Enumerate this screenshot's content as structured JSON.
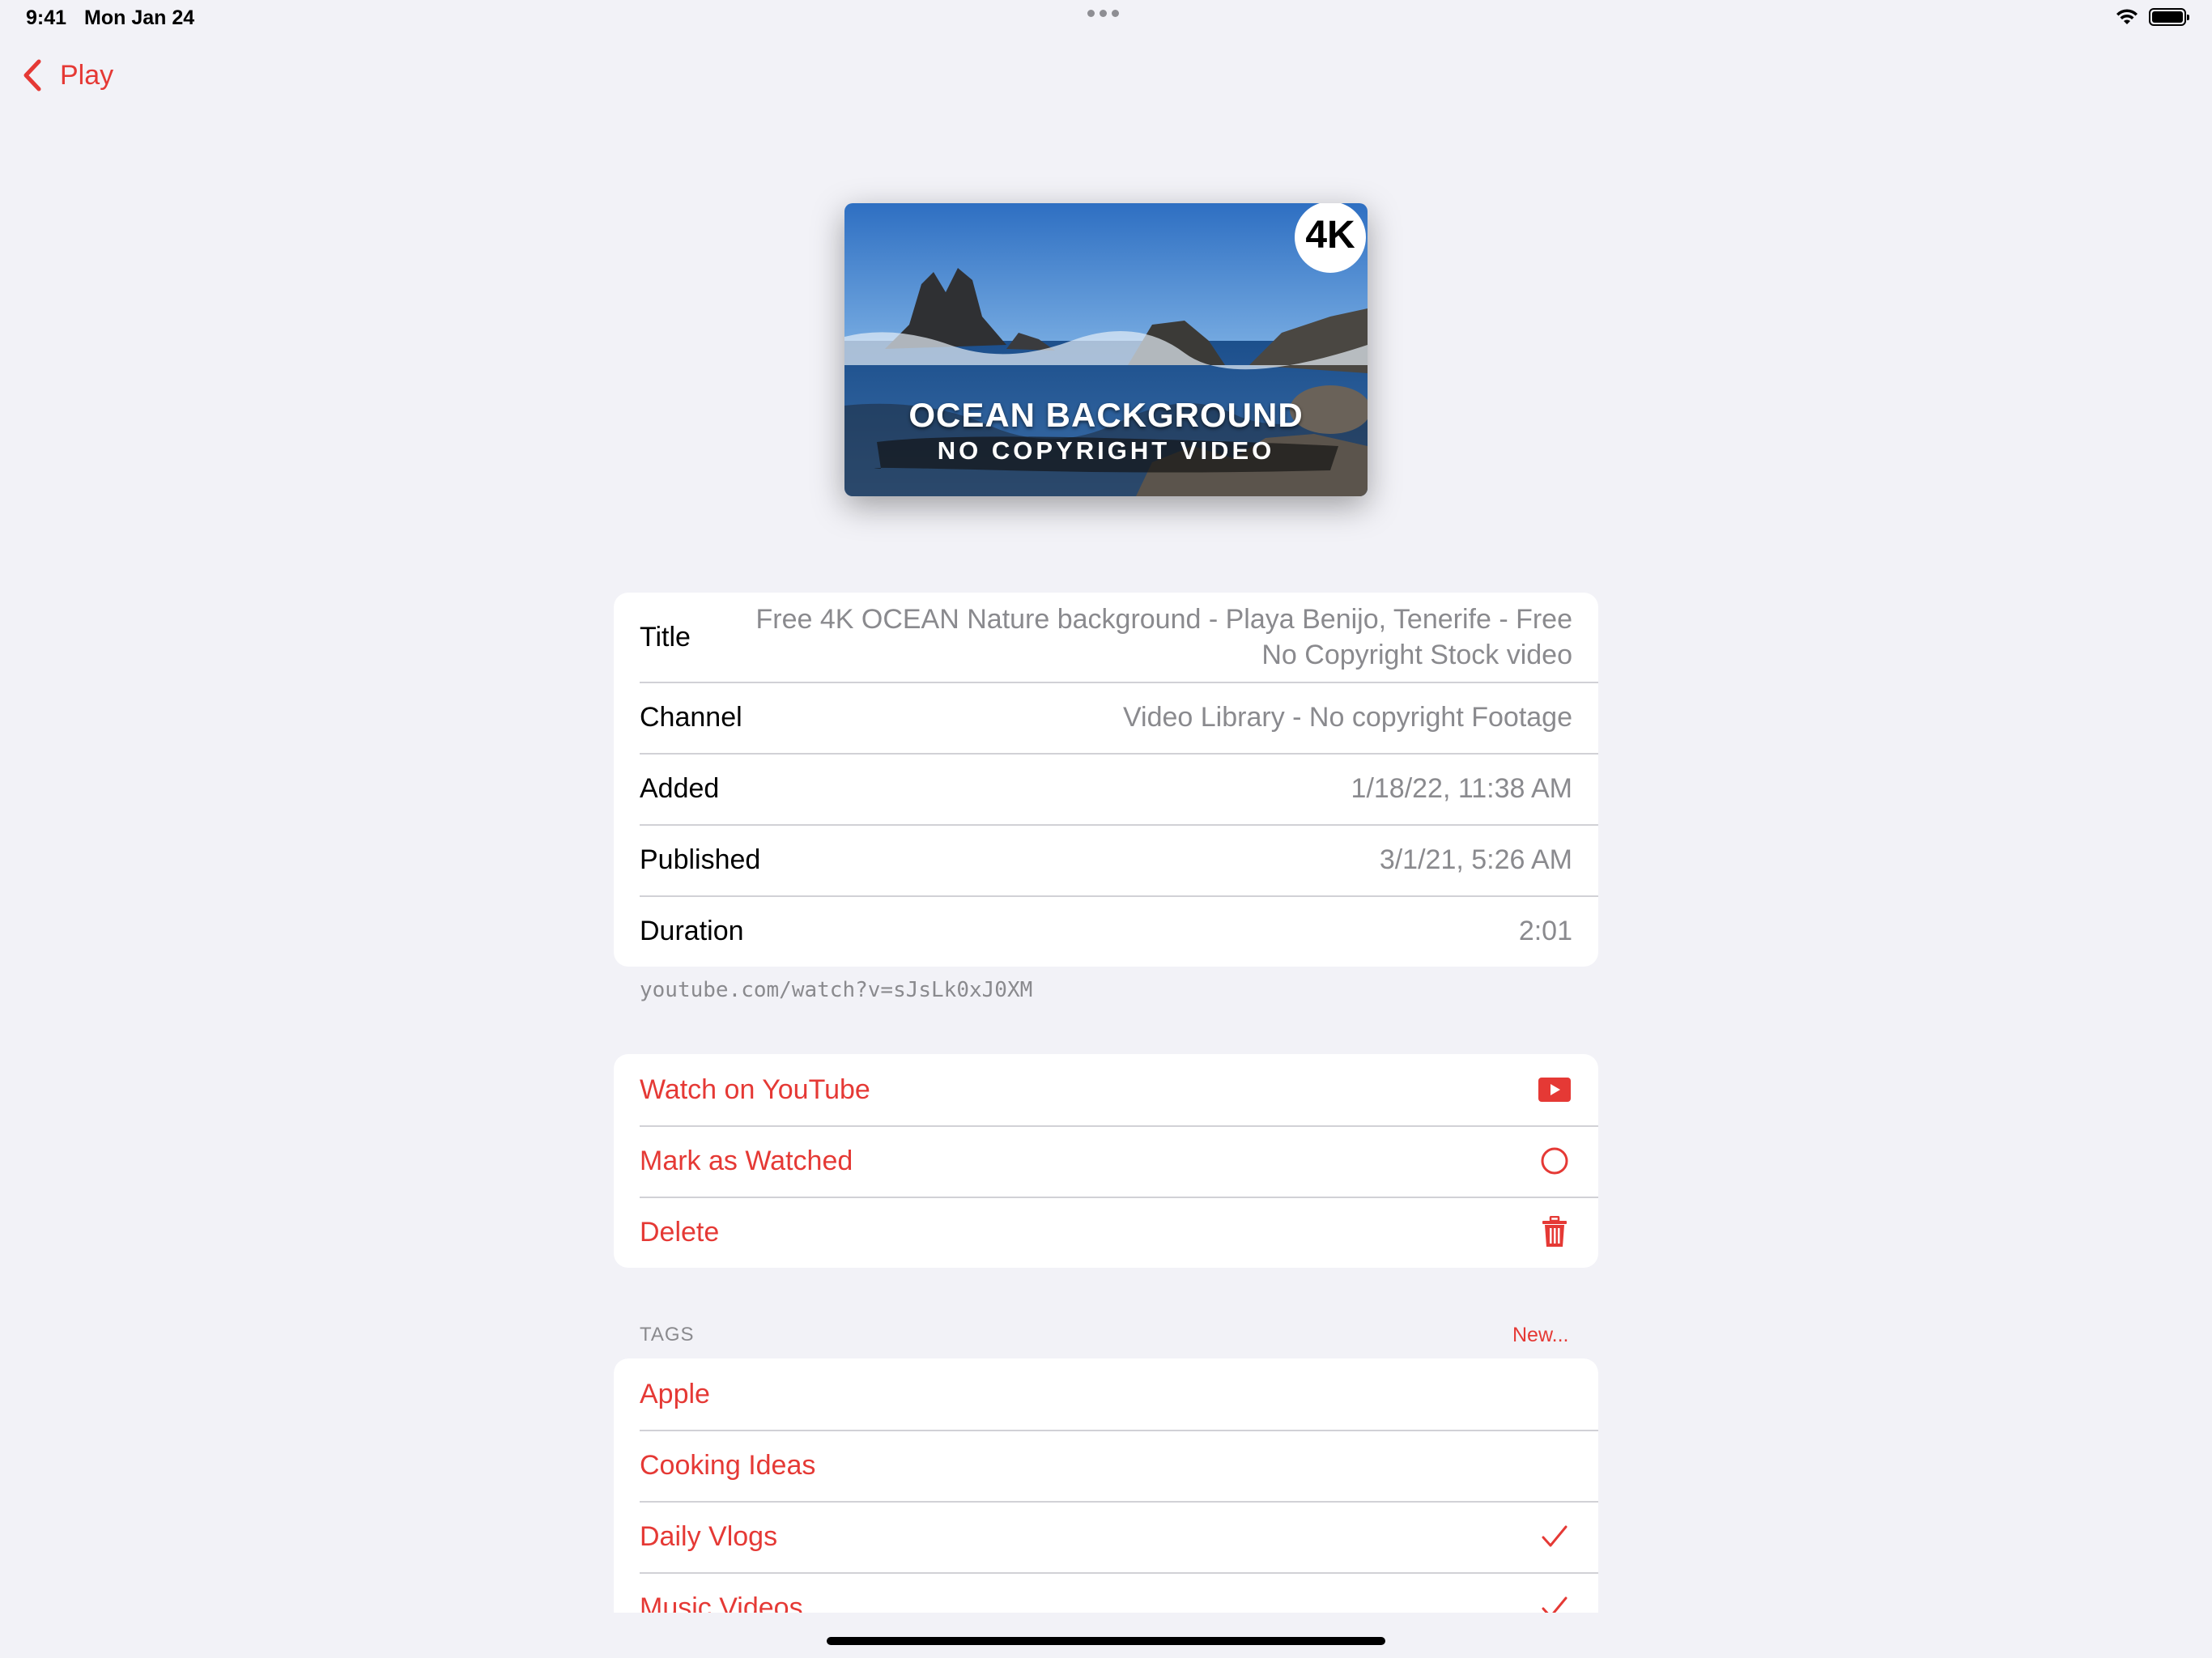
{
  "status_bar": {
    "time": "9:41",
    "date": "Mon Jan 24"
  },
  "nav": {
    "back_label": "Play"
  },
  "thumbnail": {
    "line1": "OCEAN BACKGROUND",
    "line2": "NO COPYRIGHT VIDEO",
    "badge": "4K"
  },
  "details": [
    {
      "label": "Title",
      "value": "Free 4K  OCEAN Nature background - Playa Benijo, Tenerife - Free No Copyright Stock video"
    },
    {
      "label": "Channel",
      "value": "Video Library - No copyright Footage"
    },
    {
      "label": "Added",
      "value": "1/18/22, 11:38 AM"
    },
    {
      "label": "Published",
      "value": "3/1/21, 5:26 AM"
    },
    {
      "label": "Duration",
      "value": "2:01"
    }
  ],
  "url": "youtube.com/watch?v=sJsLk0xJ0XM",
  "actions": [
    {
      "label": "Watch on YouTube",
      "icon": "youtube-icon"
    },
    {
      "label": "Mark as Watched",
      "icon": "circle-icon"
    },
    {
      "label": "Delete",
      "icon": "trash-icon"
    }
  ],
  "tags": {
    "header": "TAGS",
    "new_label": "New...",
    "items": [
      {
        "label": "Apple",
        "checked": false
      },
      {
        "label": "Cooking Ideas",
        "checked": false
      },
      {
        "label": "Daily Vlogs",
        "checked": true
      },
      {
        "label": "Music Videos",
        "checked": true
      }
    ]
  },
  "colors": {
    "accent": "#E53935",
    "background": "#F2F2F7",
    "secondary_text": "#8A8A8E"
  }
}
